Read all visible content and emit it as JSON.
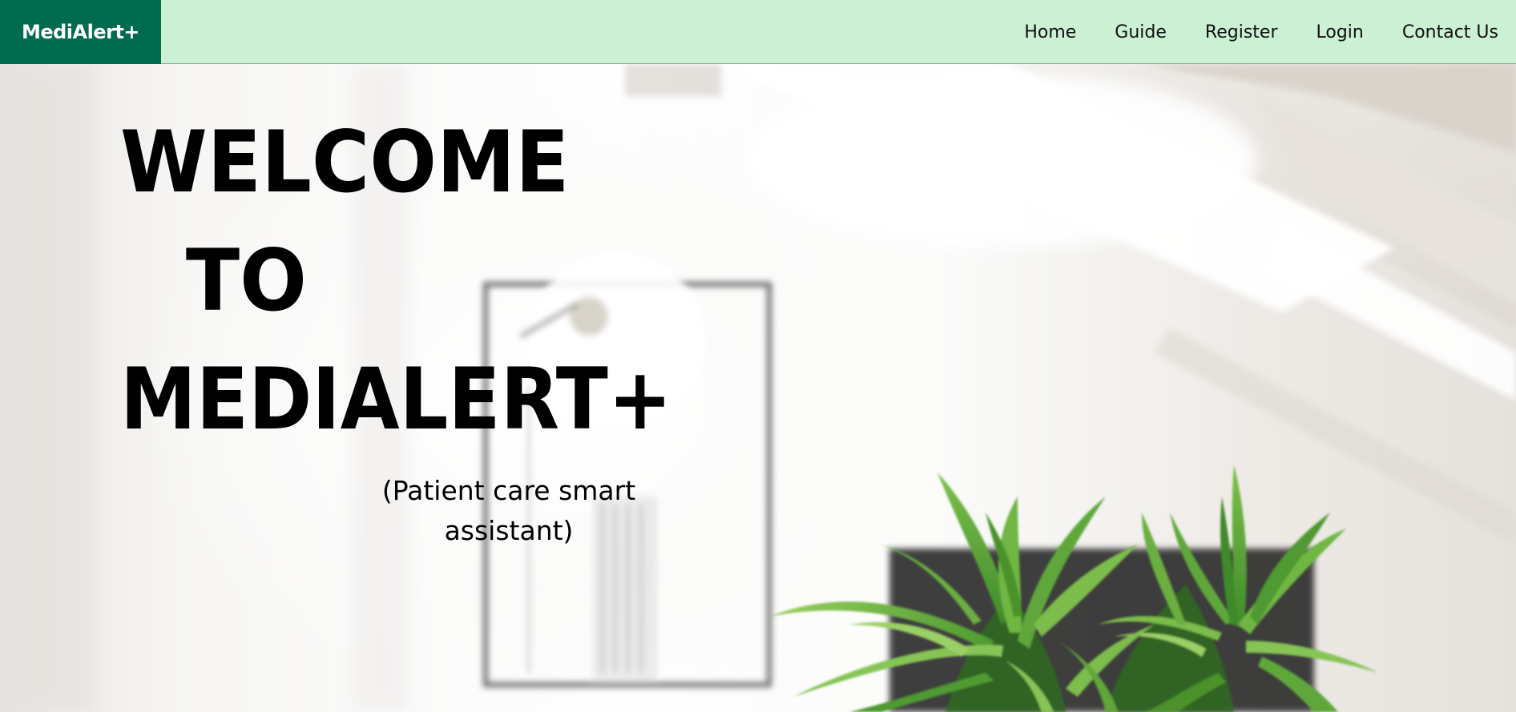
{
  "navbar": {
    "brand": "MediAlert+",
    "links": [
      "Home",
      "Guide",
      "Register",
      "Login",
      "Contact Us"
    ]
  },
  "hero": {
    "title_line1": "WELCOME",
    "title_line2": "TO",
    "title_line3": "MEDIALERT+",
    "subtitle": "(Patient care smart assistant)"
  },
  "colors": {
    "brand_bg": "#006b4f",
    "navbar_bg": "#cbf0d3",
    "plant_green": "#5aa63a"
  }
}
